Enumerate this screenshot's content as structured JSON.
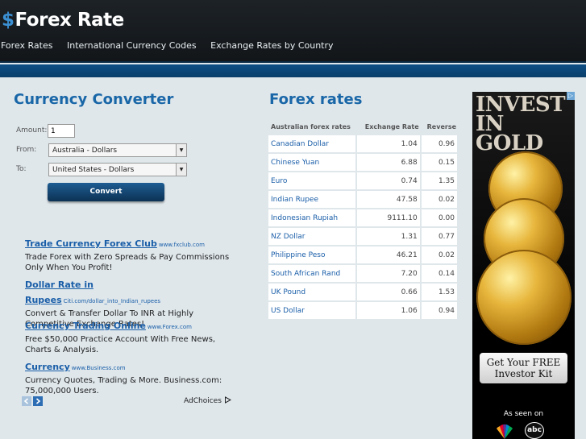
{
  "header": {
    "logo_symbol": "$",
    "logo_text": "Forex Rate",
    "nav": [
      "Forex Rates",
      "International Currency Codes",
      "Exchange Rates by Country"
    ]
  },
  "converter": {
    "title": "Currency Converter",
    "amount_label": "Amount:",
    "amount_value": "1",
    "from_label": "From:",
    "from_value": "Australia - Dollars",
    "to_label": "To:",
    "to_value": "United States - Dollars",
    "convert_label": "Convert"
  },
  "ads": [
    {
      "title": "Trade Currency Forex Club",
      "url": "www.fxclub.com",
      "desc": "Trade Forex with Zero Spreads & Pay Commissions Only When You Profit!"
    },
    {
      "title": "Dollar Rate in Rupees",
      "url": "Citi.com/dollar_into_Indian_rupees",
      "desc": "Convert & Transfer Dollar To INR at Highly Competitive Exchange Rates!"
    },
    {
      "title": "Currency Trading Online",
      "url": "www.Forex.com",
      "desc": "Free $50,000 Practice Account With Free News, Charts & Analysis."
    },
    {
      "title": "Currency",
      "url": "www.Business.com",
      "desc": "Currency Quotes, Trading & More. Business.com: 75,000,000 Users."
    }
  ],
  "adchoices_label": "AdChoices",
  "forex": {
    "title": "Forex rates",
    "columns": [
      "Australian forex rates",
      "Exchange Rate",
      "Reverse"
    ],
    "rows": [
      {
        "name": "Canadian Dollar",
        "rate": "1.04",
        "reverse": "0.96"
      },
      {
        "name": "Chinese Yuan",
        "rate": "6.88",
        "reverse": "0.15"
      },
      {
        "name": "Euro",
        "rate": "0.74",
        "reverse": "1.35"
      },
      {
        "name": "Indian Rupee",
        "rate": "47.58",
        "reverse": "0.02"
      },
      {
        "name": "Indonesian Rupiah",
        "rate": "9111.10",
        "reverse": "0.00"
      },
      {
        "name": "NZ Dollar",
        "rate": "1.31",
        "reverse": "0.77"
      },
      {
        "name": "Philippine Peso",
        "rate": "46.21",
        "reverse": "0.02"
      },
      {
        "name": "South African Rand",
        "rate": "7.20",
        "reverse": "0.14"
      },
      {
        "name": "UK Pound",
        "rate": "0.66",
        "reverse": "1.53"
      },
      {
        "name": "US Dollar",
        "rate": "1.06",
        "reverse": "0.94"
      }
    ]
  },
  "banner": {
    "headline_1": "INVEST",
    "headline_2": "IN GOLD",
    "cta_1": "Get Your FREE",
    "cta_2": "Investor Kit",
    "seen_on": "As seen on",
    "network_label": "abc"
  },
  "colors": {
    "link_blue": "#1a5ea8",
    "title_blue": "#1a67a8",
    "header_bg": "#1d2227",
    "gold": "#e7b63c"
  }
}
